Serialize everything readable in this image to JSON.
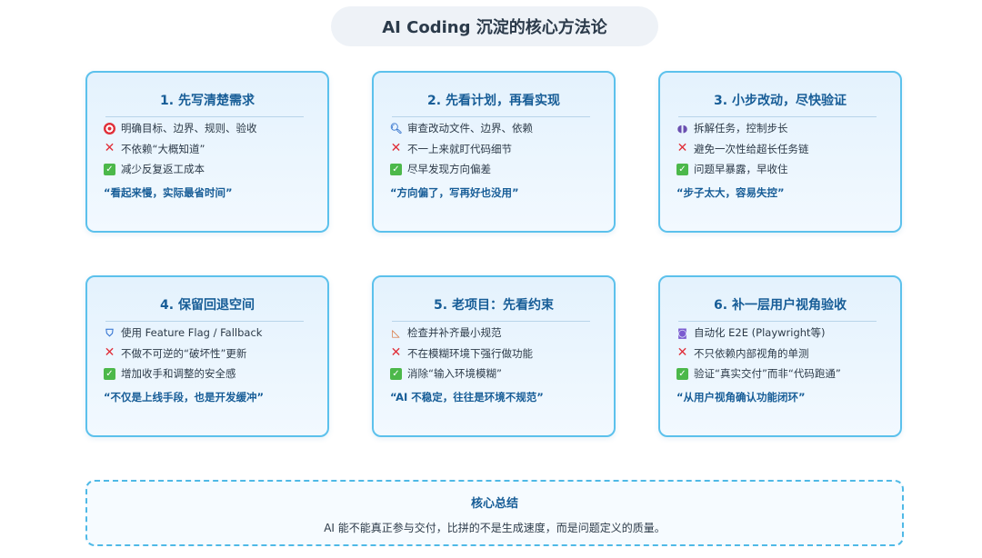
{
  "title": "AI Coding 沉淀的核心方法论",
  "cards": [
    {
      "title": "1. 先写清楚需求",
      "items": [
        {
          "icon": "target-icon",
          "text": "明确目标、边界、规则、验收"
        },
        {
          "icon": "cross-icon",
          "text": "不依赖“大概知道”"
        },
        {
          "icon": "check-icon",
          "text": "减少反复返工成本"
        }
      ],
      "quote": "“看起来慢，实际最省时间”"
    },
    {
      "title": "2. 先看计划，再看实现",
      "items": [
        {
          "icon": "magnifier-icon",
          "text": "审查改动文件、边界、依赖"
        },
        {
          "icon": "cross-icon",
          "text": "不一上来就盯代码细节"
        },
        {
          "icon": "check-icon",
          "text": "尽早发现方向偏差"
        }
      ],
      "quote": "“方向偏了，写再好也没用”"
    },
    {
      "title": "3. 小步改动，尽快验证",
      "items": [
        {
          "icon": "footprints-icon",
          "text": "拆解任务，控制步长"
        },
        {
          "icon": "cross-icon",
          "text": "避免一次性给超长任务链"
        },
        {
          "icon": "check-icon",
          "text": "问题早暴露，早收住"
        }
      ],
      "quote": "“步子太大，容易失控”"
    },
    {
      "title": "4. 保留回退空间",
      "items": [
        {
          "icon": "shield-icon",
          "text": "使用 Feature Flag / Fallback"
        },
        {
          "icon": "cross-icon",
          "text": "不做不可逆的“破坏性”更新"
        },
        {
          "icon": "check-icon",
          "text": "增加收手和调整的安全感"
        }
      ],
      "quote": "“不仅是上线手段，也是开发缓冲”"
    },
    {
      "title": "5. 老项目：先看约束",
      "items": [
        {
          "icon": "ruler-icon",
          "text": "检查并补齐最小规范"
        },
        {
          "icon": "cross-icon",
          "text": "不在模糊环境下强行做功能"
        },
        {
          "icon": "check-icon",
          "text": "消除“输入环境模糊”"
        }
      ],
      "quote": "“AI 不稳定，往往是环境不规范”"
    },
    {
      "title": "6. 补一层用户视角验收",
      "items": [
        {
          "icon": "robot-icon",
          "text": "自动化 E2E (Playwright等)"
        },
        {
          "icon": "cross-icon",
          "text": "不只依赖内部视角的单测"
        },
        {
          "icon": "check-icon",
          "text": "验证“真实交付”而非“代码跑通”"
        }
      ],
      "quote": "“从用户视角确认功能闭环”"
    }
  ],
  "summary": {
    "title": "核心总结",
    "text": "AI 能不能真正参与交付，比拼的不是生成速度，而是问题定义的质量。"
  }
}
